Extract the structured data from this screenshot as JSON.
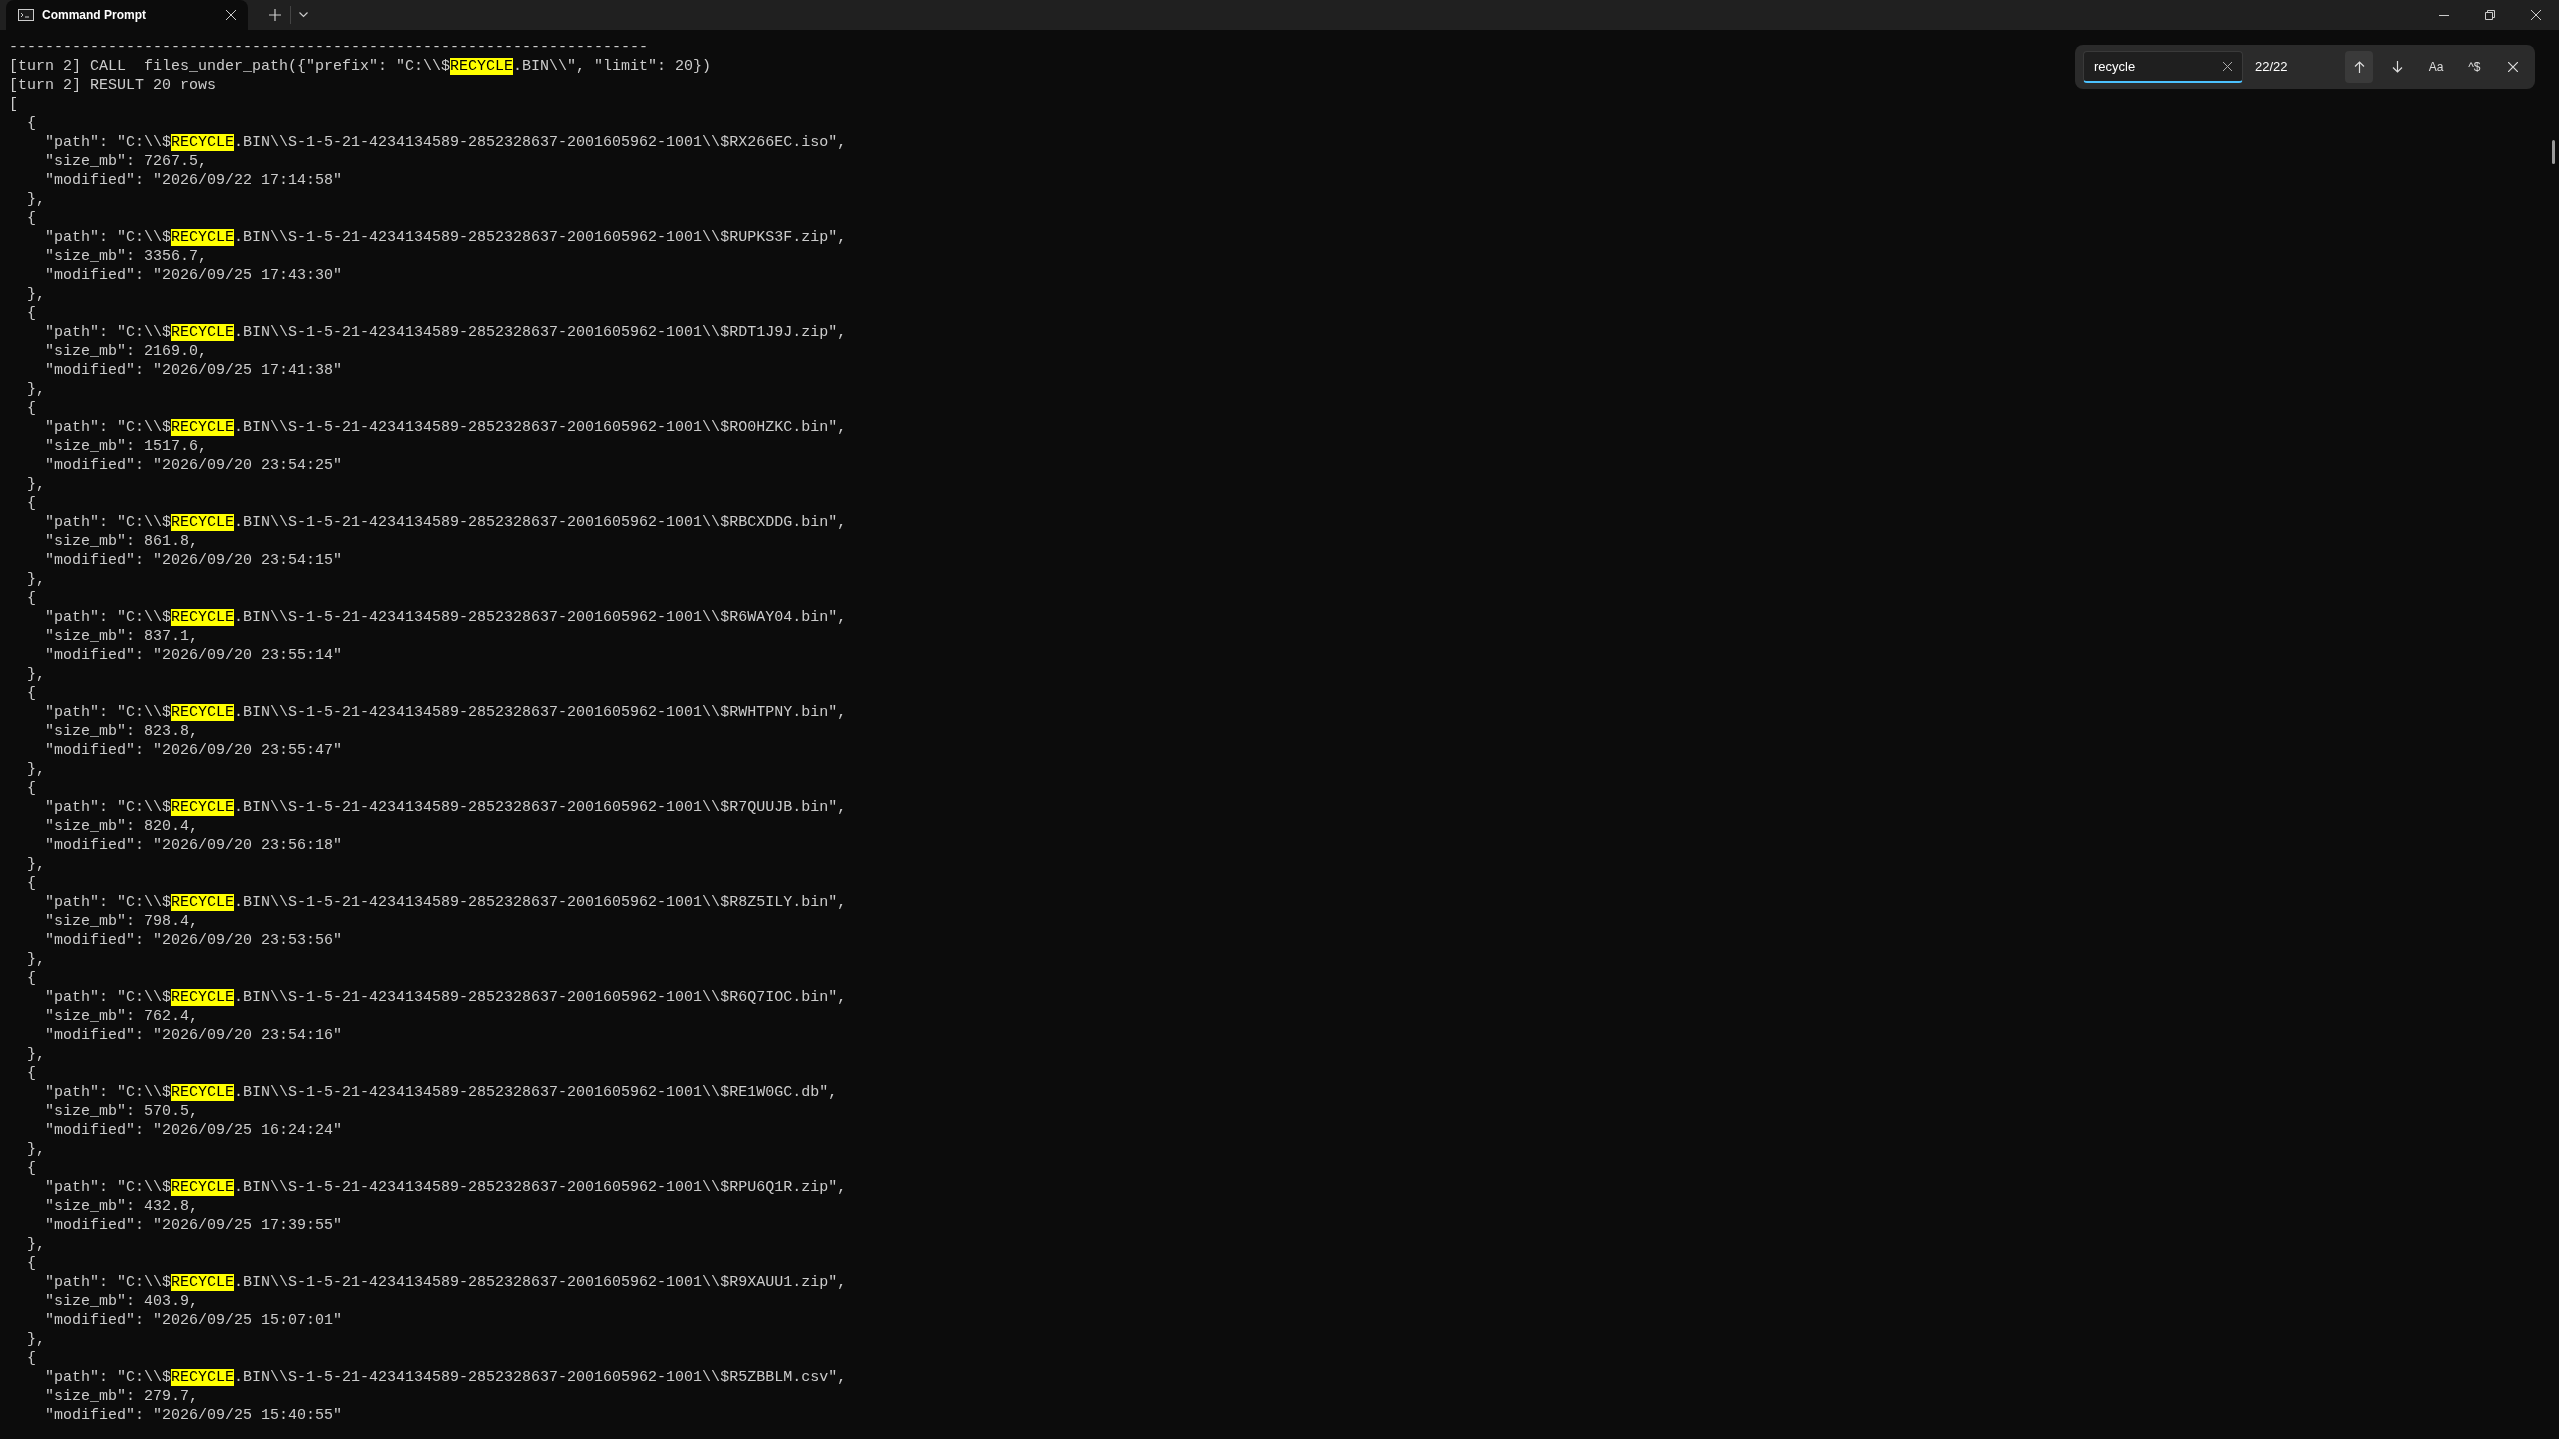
{
  "window": {
    "tabs": [
      {
        "title": "Command Prompt",
        "selected": true
      }
    ]
  },
  "find_bar": {
    "value": "recycle",
    "count": "22/22",
    "buttons": [
      {
        "kind": "up",
        "hovered": true
      },
      {
        "kind": "down",
        "hovered": false
      },
      {
        "kind": "text",
        "label": "Aa",
        "hovered": false
      },
      {
        "kind": "text",
        "label": "^$",
        "hovered": false
      },
      {
        "kind": "close",
        "hovered": false
      }
    ]
  },
  "terminal": {
    "lines": [
      [
        {
          "text": "-----------------------------------------------------------------------",
          "match": false
        }
      ],
      [
        {
          "text": "[turn 2] CALL  files_under_path({\"prefix\": \"C:\\\\$",
          "match": false
        },
        {
          "text": "RECYCLE",
          "match": true
        },
        {
          "text": ".BIN\\\\\", \"limit\": 20})",
          "match": false
        }
      ],
      [
        {
          "text": "[turn 2] RESULT 20 rows",
          "match": false
        }
      ],
      [
        {
          "text": "[",
          "match": false
        }
      ],
      [
        {
          "text": "  {",
          "match": false
        }
      ],
      [
        {
          "text": "    \"path\": \"C:\\\\$",
          "match": false
        },
        {
          "text": "RECYCLE",
          "match": true
        },
        {
          "text": ".BIN\\\\S-1-5-21-4234134589-2852328637-2001605962-1001\\\\$RX266EC.iso\",",
          "match": false
        }
      ],
      [
        {
          "text": "    \"size_mb\": 7267.5,",
          "match": false
        }
      ],
      [
        {
          "text": "    \"modified\": \"2026/09/22 17:14:58\"",
          "match": false
        }
      ],
      [
        {
          "text": "  },",
          "match": false
        }
      ],
      [
        {
          "text": "  {",
          "match": false
        }
      ],
      [
        {
          "text": "    \"path\": \"C:\\\\$",
          "match": false
        },
        {
          "text": "RECYCLE",
          "match": true
        },
        {
          "text": ".BIN\\\\S-1-5-21-4234134589-2852328637-2001605962-1001\\\\$RUPKS3F.zip\",",
          "match": false
        }
      ],
      [
        {
          "text": "    \"size_mb\": 3356.7,",
          "match": false
        }
      ],
      [
        {
          "text": "    \"modified\": \"2026/09/25 17:43:30\"",
          "match": false
        }
      ],
      [
        {
          "text": "  },",
          "match": false
        }
      ],
      [
        {
          "text": "  {",
          "match": false
        }
      ],
      [
        {
          "text": "    \"path\": \"C:\\\\$",
          "match": false
        },
        {
          "text": "RECYCLE",
          "match": true
        },
        {
          "text": ".BIN\\\\S-1-5-21-4234134589-2852328637-2001605962-1001\\\\$RDT1J9J.zip\",",
          "match": false
        }
      ],
      [
        {
          "text": "    \"size_mb\": 2169.0,",
          "match": false
        }
      ],
      [
        {
          "text": "    \"modified\": \"2026/09/25 17:41:38\"",
          "match": false
        }
      ],
      [
        {
          "text": "  },",
          "match": false
        }
      ],
      [
        {
          "text": "  {",
          "match": false
        }
      ],
      [
        {
          "text": "    \"path\": \"C:\\\\$",
          "match": false
        },
        {
          "text": "RECYCLE",
          "match": true
        },
        {
          "text": ".BIN\\\\S-1-5-21-4234134589-2852328637-2001605962-1001\\\\$RO0HZKC.bin\",",
          "match": false
        }
      ],
      [
        {
          "text": "    \"size_mb\": 1517.6,",
          "match": false
        }
      ],
      [
        {
          "text": "    \"modified\": \"2026/09/20 23:54:25\"",
          "match": false
        }
      ],
      [
        {
          "text": "  },",
          "match": false
        }
      ],
      [
        {
          "text": "  {",
          "match": false
        }
      ],
      [
        {
          "text": "    \"path\": \"C:\\\\$",
          "match": false
        },
        {
          "text": "RECYCLE",
          "match": true
        },
        {
          "text": ".BIN\\\\S-1-5-21-4234134589-2852328637-2001605962-1001\\\\$RBCXDDG.bin\",",
          "match": false
        }
      ],
      [
        {
          "text": "    \"size_mb\": 861.8,",
          "match": false
        }
      ],
      [
        {
          "text": "    \"modified\": \"2026/09/20 23:54:15\"",
          "match": false
        }
      ],
      [
        {
          "text": "  },",
          "match": false
        }
      ],
      [
        {
          "text": "  {",
          "match": false
        }
      ],
      [
        {
          "text": "    \"path\": \"C:\\\\$",
          "match": false
        },
        {
          "text": "RECYCLE",
          "match": true
        },
        {
          "text": ".BIN\\\\S-1-5-21-4234134589-2852328637-2001605962-1001\\\\$R6WAY04.bin\",",
          "match": false
        }
      ],
      [
        {
          "text": "    \"size_mb\": 837.1,",
          "match": false
        }
      ],
      [
        {
          "text": "    \"modified\": \"2026/09/20 23:55:14\"",
          "match": false
        }
      ],
      [
        {
          "text": "  },",
          "match": false
        }
      ],
      [
        {
          "text": "  {",
          "match": false
        }
      ],
      [
        {
          "text": "    \"path\": \"C:\\\\$",
          "match": false
        },
        {
          "text": "RECYCLE",
          "match": true
        },
        {
          "text": ".BIN\\\\S-1-5-21-4234134589-2852328637-2001605962-1001\\\\$RWHTPNY.bin\",",
          "match": false
        }
      ],
      [
        {
          "text": "    \"size_mb\": 823.8,",
          "match": false
        }
      ],
      [
        {
          "text": "    \"modified\": \"2026/09/20 23:55:47\"",
          "match": false
        }
      ],
      [
        {
          "text": "  },",
          "match": false
        }
      ],
      [
        {
          "text": "  {",
          "match": false
        }
      ],
      [
        {
          "text": "    \"path\": \"C:\\\\$",
          "match": false
        },
        {
          "text": "RECYCLE",
          "match": true
        },
        {
          "text": ".BIN\\\\S-1-5-21-4234134589-2852328637-2001605962-1001\\\\$R7QUUJB.bin\",",
          "match": false
        }
      ],
      [
        {
          "text": "    \"size_mb\": 820.4,",
          "match": false
        }
      ],
      [
        {
          "text": "    \"modified\": \"2026/09/20 23:56:18\"",
          "match": false
        }
      ],
      [
        {
          "text": "  },",
          "match": false
        }
      ],
      [
        {
          "text": "  {",
          "match": false
        }
      ],
      [
        {
          "text": "    \"path\": \"C:\\\\$",
          "match": false
        },
        {
          "text": "RECYCLE",
          "match": true
        },
        {
          "text": ".BIN\\\\S-1-5-21-4234134589-2852328637-2001605962-1001\\\\$R8Z5ILY.bin\",",
          "match": false
        }
      ],
      [
        {
          "text": "    \"size_mb\": 798.4,",
          "match": false
        }
      ],
      [
        {
          "text": "    \"modified\": \"2026/09/20 23:53:56\"",
          "match": false
        }
      ],
      [
        {
          "text": "  },",
          "match": false
        }
      ],
      [
        {
          "text": "  {",
          "match": false
        }
      ],
      [
        {
          "text": "    \"path\": \"C:\\\\$",
          "match": false
        },
        {
          "text": "RECYCLE",
          "match": true
        },
        {
          "text": ".BIN\\\\S-1-5-21-4234134589-2852328637-2001605962-1001\\\\$R6Q7IOC.bin\",",
          "match": false
        }
      ],
      [
        {
          "text": "    \"size_mb\": 762.4,",
          "match": false
        }
      ],
      [
        {
          "text": "    \"modified\": \"2026/09/20 23:54:16\"",
          "match": false
        }
      ],
      [
        {
          "text": "  },",
          "match": false
        }
      ],
      [
        {
          "text": "  {",
          "match": false
        }
      ],
      [
        {
          "text": "    \"path\": \"C:\\\\$",
          "match": false
        },
        {
          "text": "RECYCLE",
          "match": true
        },
        {
          "text": ".BIN\\\\S-1-5-21-4234134589-2852328637-2001605962-1001\\\\$RE1W0GC.db\",",
          "match": false
        }
      ],
      [
        {
          "text": "    \"size_mb\": 570.5,",
          "match": false
        }
      ],
      [
        {
          "text": "    \"modified\": \"2026/09/25 16:24:24\"",
          "match": false
        }
      ],
      [
        {
          "text": "  },",
          "match": false
        }
      ],
      [
        {
          "text": "  {",
          "match": false
        }
      ],
      [
        {
          "text": "    \"path\": \"C:\\\\$",
          "match": false
        },
        {
          "text": "RECYCLE",
          "match": true
        },
        {
          "text": ".BIN\\\\S-1-5-21-4234134589-2852328637-2001605962-1001\\\\$RPU6Q1R.zip\",",
          "match": false
        }
      ],
      [
        {
          "text": "    \"size_mb\": 432.8,",
          "match": false
        }
      ],
      [
        {
          "text": "    \"modified\": \"2026/09/25 17:39:55\"",
          "match": false
        }
      ],
      [
        {
          "text": "  },",
          "match": false
        }
      ],
      [
        {
          "text": "  {",
          "match": false
        }
      ],
      [
        {
          "text": "    \"path\": \"C:\\\\$",
          "match": false
        },
        {
          "text": "RECYCLE",
          "match": true
        },
        {
          "text": ".BIN\\\\S-1-5-21-4234134589-2852328637-2001605962-1001\\\\$R9XAUU1.zip\",",
          "match": false
        }
      ],
      [
        {
          "text": "    \"size_mb\": 403.9,",
          "match": false
        }
      ],
      [
        {
          "text": "    \"modified\": \"2026/09/25 15:07:01\"",
          "match": false
        }
      ],
      [
        {
          "text": "  },",
          "match": false
        }
      ],
      [
        {
          "text": "  {",
          "match": false
        }
      ],
      [
        {
          "text": "    \"path\": \"C:\\\\$",
          "match": false
        },
        {
          "text": "RECYCLE",
          "match": true
        },
        {
          "text": ".BIN\\\\S-1-5-21-4234134589-2852328637-2001605962-1001\\\\$R5ZBBLM.csv\",",
          "match": false
        }
      ],
      [
        {
          "text": "    \"size_mb\": 279.7,",
          "match": false
        }
      ],
      [
        {
          "text": "    \"modified\": \"2026/09/25 15:40:55\"",
          "match": false
        }
      ]
    ]
  }
}
